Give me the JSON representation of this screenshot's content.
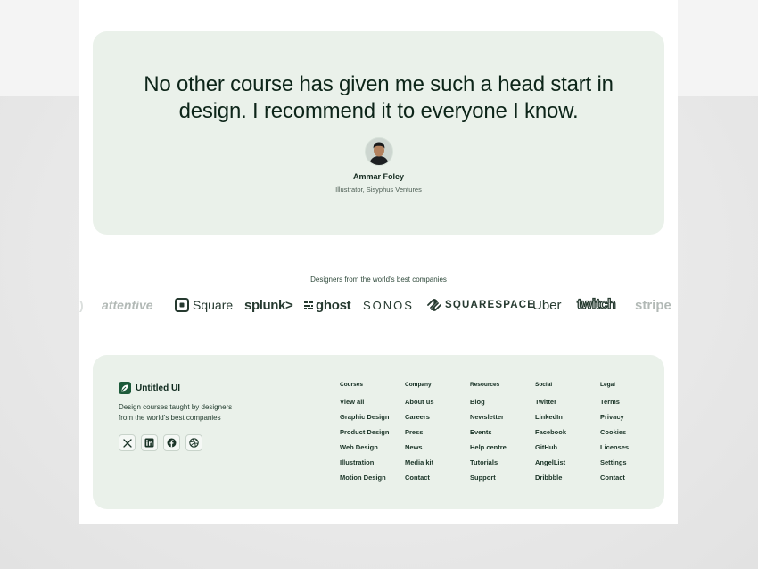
{
  "testimonial": {
    "quote": "No other course has given me such a head start in design. I recommend it to everyone I know.",
    "author_name": "Ammar Foley",
    "author_role": "Illustrator, Sisyphus Ventures"
  },
  "logos": {
    "caption": "Designers from the world’s best companies",
    "items": [
      "attentive",
      "Square",
      "splunk>",
      "ghost",
      "SONOS",
      "SQUARESPACE",
      "Uber",
      "twitch",
      "stripe"
    ]
  },
  "footer": {
    "brand_name": "Untitled UI",
    "tagline": "Design courses taught by designers from the world’s best companies",
    "socials": [
      "x-icon",
      "linkedin-icon",
      "facebook-icon",
      "dribbble-icon"
    ],
    "columns": [
      {
        "title": "Courses",
        "links": [
          "View all",
          "Graphic Design",
          "Product Design",
          "Web Design",
          "Illustration",
          "Motion Design"
        ]
      },
      {
        "title": "Company",
        "links": [
          "About us",
          "Careers",
          "Press",
          "News",
          "Media kit",
          "Contact"
        ]
      },
      {
        "title": "Resources",
        "links": [
          "Blog",
          "Newsletter",
          "Events",
          "Help centre",
          "Tutorials",
          "Support"
        ]
      },
      {
        "title": "Social",
        "links": [
          "Twitter",
          "LinkedIn",
          "Facebook",
          "GitHub",
          "AngelList",
          "Dribbble"
        ]
      },
      {
        "title": "Legal",
        "links": [
          "Terms",
          "Privacy",
          "Cookies",
          "Licenses",
          "Settings",
          "Contact"
        ]
      }
    ]
  },
  "colors": {
    "accent": "#1d5a3a",
    "panel": "#eaf1ea",
    "text": "#0f2a1e"
  }
}
